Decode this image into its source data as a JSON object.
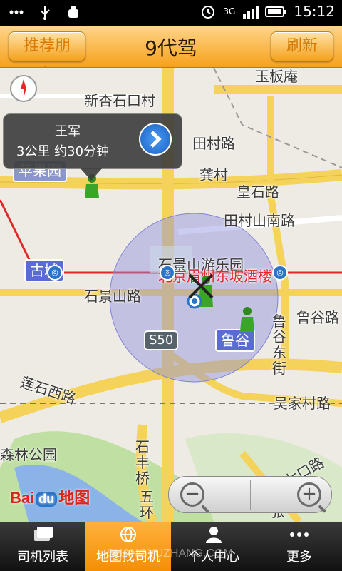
{
  "status_bar": {
    "time": "15:12",
    "network": "3G",
    "icons": [
      "more-dots-icon",
      "usb-icon",
      "android-debug-icon",
      "alarm-icon",
      "signal-icon",
      "battery-icon"
    ]
  },
  "header": {
    "left_button": "推荐朋友",
    "title": "9代驾",
    "right_button": "刷新"
  },
  "map": {
    "callout": {
      "name": "王军",
      "info": "3公里  约30分钟"
    },
    "labels": {
      "yubanyan": "玉板庵",
      "xinxingshikou": "新杏石口村",
      "tiancun_road": "田村路",
      "gongcun": "龚村",
      "pingguoyuan": "苹果园",
      "huangshi_road": "皇石路",
      "tiancun_shannan": "田村山南路",
      "gucheng": "古城",
      "shijingshan_park": "石景山游乐园",
      "hotel": "北京眉州东坡酒楼",
      "shijingshan_road": "石景山路",
      "lugu_road": "鲁谷路",
      "s50": "S50",
      "lugu": "鲁谷",
      "lugu_east": "鲁谷东街",
      "lianshi_west": "莲石西路",
      "wujiacun_road": "吴家村路",
      "senlin_park": "森林公园",
      "shifeng_bridge": "石丰桥",
      "wuhuan": "五环",
      "qili_road": "七口路",
      "zhang": "张"
    },
    "baidu_logo_text": "Bai",
    "baidu_logo_paw": "du",
    "baidu_logo_suffix": "地图",
    "zoom": {
      "out": "−",
      "in": "+"
    }
  },
  "tabs": [
    {
      "label": "司机列表",
      "icon": "driver-list-icon",
      "active": false
    },
    {
      "label": "地图找司机",
      "icon": "globe-icon",
      "active": true
    },
    {
      "label": "个人中心",
      "icon": "person-icon",
      "active": false
    },
    {
      "label": "更多",
      "icon": "more-dots-icon",
      "active": false
    }
  ],
  "watermark": "SHANGYUZHANG.COM",
  "colors": {
    "accent": "#f6a11c",
    "accuracy_circle": "#8c8fe0",
    "metro_line": "#e02a2a",
    "road_major": "#f5d35a"
  }
}
